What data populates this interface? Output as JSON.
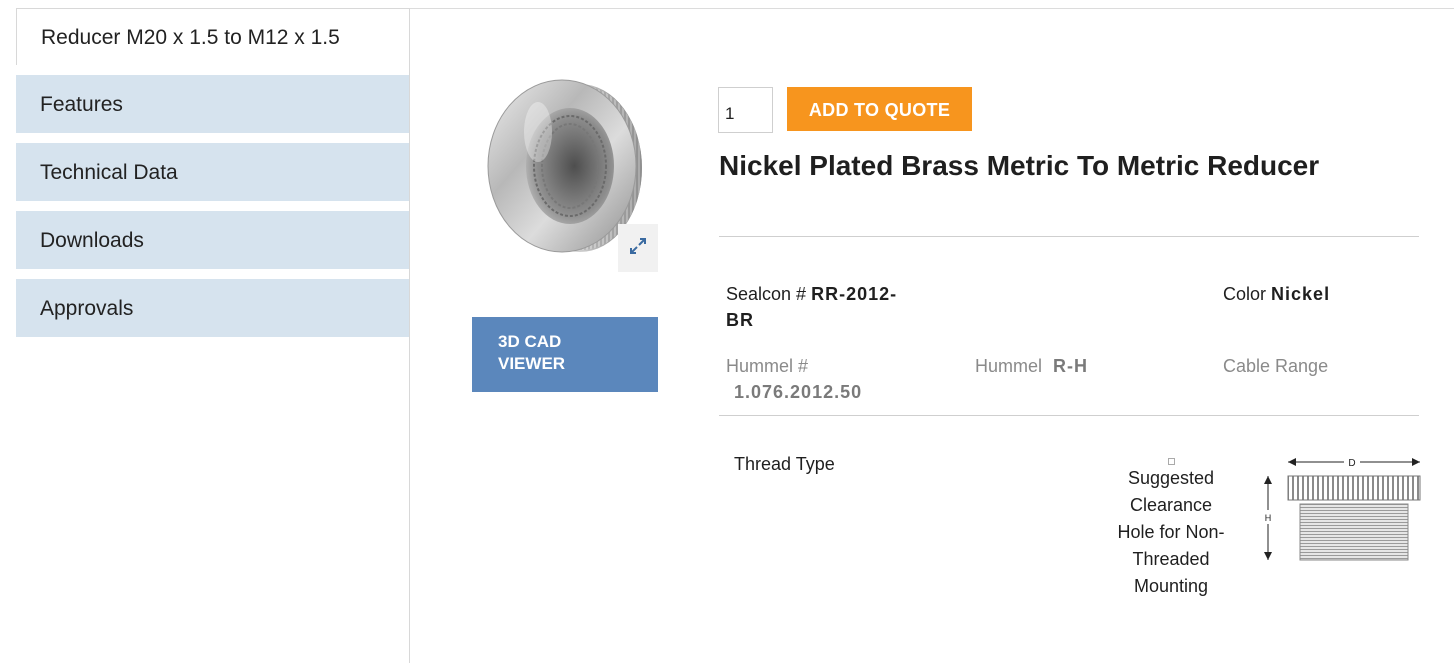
{
  "tab": {
    "label": "Reducer M20 x 1.5 to M12 x 1.5"
  },
  "sidebar": {
    "items": [
      {
        "label": "Features"
      },
      {
        "label": "Technical Data"
      },
      {
        "label": "Downloads"
      },
      {
        "label": "Approvals"
      }
    ]
  },
  "cad_viewer": {
    "label_line1": "3D CAD",
    "label_line2": "VIEWER"
  },
  "order": {
    "quantity": "1",
    "add_button": "ADD TO QUOTE"
  },
  "product": {
    "title": "Nickel Plated Brass Metric To Metric Reducer"
  },
  "specs": {
    "sealcon_label": "Sealcon #",
    "sealcon_value_1": "RR-2012-",
    "sealcon_value_2": "BR",
    "color_label": "Color",
    "color_value": "Nickel",
    "hummel_num_label": "Hummel #",
    "hummel_num_value": "1.076.2012.50",
    "hummel_label": "Hummel",
    "hummel_value": "R-H",
    "cable_range_label": "Cable Range",
    "thread_type_label": "Thread Type"
  },
  "clearance": {
    "lines": [
      "Suggested",
      "Clearance",
      "Hole for Non-",
      "Threaded",
      "Mounting"
    ]
  },
  "diagram": {
    "width_label": "D",
    "height_label": "H"
  },
  "colors": {
    "nav_bg": "#d6e3ee",
    "cad_button": "#5b87bc",
    "quote_button": "#f7951e"
  },
  "icons": {
    "expand": "expand-icon"
  }
}
